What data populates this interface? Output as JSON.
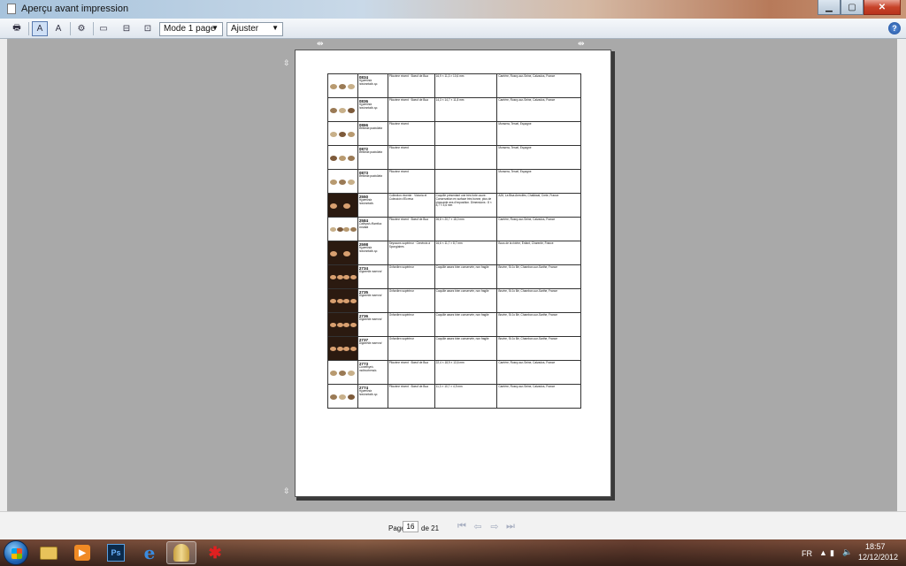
{
  "window": {
    "title": "Aperçu avant impression"
  },
  "toolbar": {
    "mode_select": "Mode 1 page",
    "zoom_select": "Ajuster"
  },
  "catalog_rows": [
    {
      "num": "0834",
      "species": "Hyperlinia horizontalis sp.",
      "col": "Pliocène récent · Boeuf de Bua",
      "dim": "16,9 × 11,3 × 10,6 mm",
      "loc": "Carrière, Rosny-sur-Seine, Calvados, France",
      "shells": 3,
      "dark": false
    },
    {
      "num": "0836",
      "species": "Hyperlinia horizontalis sp.",
      "col": "Pliocène récent · Boeuf de Bua",
      "dim": "14,3 × 14,7 × 11,8 mm",
      "loc": "Carrière, Rosny-sur-Seine, Calvados, France",
      "shells": 3,
      "dark": false
    },
    {
      "num": "0866",
      "species": "Bellanta pustuliata",
      "col": "Pliocène récent",
      "dim": "",
      "loc": "Monsera, Teruel, Espagne",
      "shells": 3,
      "dark": false
    },
    {
      "num": "0872",
      "species": "Bellanta pustuliata",
      "col": "Pliocène récent",
      "dim": "",
      "loc": "Monsera, Teruel, Espagne",
      "shells": 3,
      "dark": false
    },
    {
      "num": "0873",
      "species": "Bellanta pustuliata",
      "col": "Pliocène récent",
      "dim": "",
      "loc": "Monsera, Teruel, Espagne",
      "shells": 3,
      "dark": false
    },
    {
      "num": "2550",
      "species": "Hyperlinia horizontalis",
      "col": "Collection récente · Victoria et Colección d'Ecreva",
      "dim": "Coquille présentant une très forte usure. Conservation en surface très bonne, plus de cinquante ans d'exposition. Dimensions : 8 × 8,7 × 5,6 mm",
      "loc": "A26, La Bisa Arrecifes, Chalkiwai, Crete, France",
      "shells": 2,
      "dark": true
    },
    {
      "num": "2584",
      "species": "Callopsis filamitus costata",
      "col": "Pliocène récent · Boeuf de Bua",
      "dim": "26,8 × 20,7 × 18,0 mm",
      "loc": "Carrière, Rosny-sur-Seine, Calvados, France",
      "shells": 4,
      "dark": false
    },
    {
      "num": "2598",
      "species": "Hyperlinia horizontalis sp.",
      "col": "Seyssons supérieur · Cenérois à Spongiaires",
      "dim": "16,6 × 11,7 × 8,7 mm",
      "loc": "Bous de la rivière, Enfant, Charente, France",
      "shells": 2,
      "dark": true
    },
    {
      "num": "2734",
      "species": "Digonella marconi",
      "col": "Oxfordien supérieur",
      "dim": "Coquille assez bien conservée, non fragile",
      "loc": "Bruère, St Jo Bé, Chambon-sur-Sarthe, France",
      "shells": 4,
      "dark": true
    },
    {
      "num": "2735",
      "species": "Digonella marconi",
      "col": "Oxfordien supérieur",
      "dim": "Coquille assez bien conservée, non fragile",
      "loc": "Bruère, St Jo Bé, Chambon-sur-Sarthe, France",
      "shells": 4,
      "dark": true
    },
    {
      "num": "2736",
      "species": "Digonella marconi",
      "col": "Oxfordien supérieur",
      "dim": "Coquille assez bien conservée, non fragile",
      "loc": "Bruère, St Jo Bé, Chambon-sur-Sarthe, France",
      "shells": 4,
      "dark": true
    },
    {
      "num": "2737",
      "species": "Digonella marconi",
      "col": "Oxfordien supérieur",
      "dim": "Coquille assez bien conservée, non fragile",
      "loc": "Bruère, St Jo Bé, Chambon-sur-Sarthe, France",
      "shells": 4,
      "dark": true
    },
    {
      "num": "2773",
      "species": "Cuneithyris moltrochensis",
      "col": "Pliocène récent · Boeuf de Bua",
      "dim": "22,4 × 18,9 × 13,6 mm",
      "loc": "Carrière, Rosny-sur-Seine, Calvados, France",
      "shells": 3,
      "dark": false
    },
    {
      "num": "2774",
      "species": "Hyperlinia horizontalis sp.",
      "col": "Pliocène récent · Boeuf de Bua",
      "dim": "11,3 × 10,7 × 4,9 mm",
      "loc": "Carrière, Rosny-sur-Seine, Calvados, France",
      "shells": 3,
      "dark": false
    }
  ],
  "pager": {
    "page_label": "Page",
    "current_page": "16",
    "of_label": "de 21"
  },
  "taskbar": {
    "lang": "FR",
    "time": "18:57",
    "date": "12/12/2012"
  },
  "colors": {
    "preview_bg": "#a9a9a9",
    "toolbar_bg": "#e6ecf2",
    "close_button": "#c7432a"
  }
}
